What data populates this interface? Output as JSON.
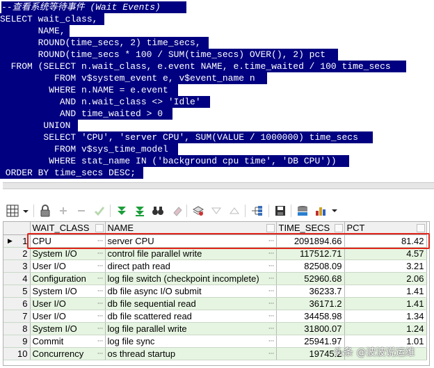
{
  "editor": {
    "lines": [
      {
        "text": "--查看系统等待事件 (Wait Events)",
        "comment": true
      },
      {
        "text": "SELECT wait_class,",
        "comment": false
      },
      {
        "text": "       NAME,",
        "comment": false
      },
      {
        "text": "       ROUND(time_secs, 2) time_secs,",
        "comment": false
      },
      {
        "text": "       ROUND(time_secs * 100 / SUM(time_secs) OVER(), 2) pct",
        "comment": false
      },
      {
        "text": "  FROM (SELECT n.wait_class, e.event NAME, e.time_waited / 100 time_secs",
        "comment": false
      },
      {
        "text": "          FROM v$system_event e, v$event_name n",
        "comment": false
      },
      {
        "text": "         WHERE n.NAME = e.event",
        "comment": false
      },
      {
        "text": "           AND n.wait_class <> 'Idle'",
        "comment": false
      },
      {
        "text": "           AND time_waited > 0",
        "comment": false
      },
      {
        "text": "        UNION",
        "comment": false
      },
      {
        "text": "        SELECT 'CPU', 'server CPU', SUM(VALUE / 1000000) time_secs",
        "comment": false
      },
      {
        "text": "          FROM v$sys_time_model",
        "comment": false
      },
      {
        "text": "         WHERE stat_name IN ('background cpu time', 'DB CPU'))",
        "comment": false
      },
      {
        "text": " ORDER BY time_secs DESC;",
        "comment": false
      }
    ]
  },
  "toolbar": {
    "buttons": [
      {
        "name": "grid-view-icon"
      },
      {
        "name": "lock-icon"
      },
      {
        "name": "add-row-icon"
      },
      {
        "name": "delete-row-icon"
      },
      {
        "name": "post-changes-icon"
      },
      {
        "name": "fetch-next-icon"
      },
      {
        "name": "fetch-all-icon"
      },
      {
        "name": "find-binoculars-icon"
      },
      {
        "name": "clear-eraser-icon"
      },
      {
        "name": "query-by-example-icon"
      },
      {
        "name": "sort-descending-icon"
      },
      {
        "name": "sort-ascending-icon"
      },
      {
        "name": "tree-view-icon"
      },
      {
        "name": "save-icon"
      },
      {
        "name": "export-icon"
      },
      {
        "name": "chart-icon"
      }
    ]
  },
  "grid": {
    "columns": [
      "WAIT_CLASS",
      "NAME",
      "TIME_SECS",
      "PCT"
    ],
    "rows": [
      {
        "num": "1",
        "wait_class": "CPU",
        "name": "server CPU",
        "time_secs": "2091894.66",
        "pct": "81.42"
      },
      {
        "num": "2",
        "wait_class": "System I/O",
        "name": "control file parallel write",
        "time_secs": "117512.71",
        "pct": "4.57"
      },
      {
        "num": "3",
        "wait_class": "User I/O",
        "name": "direct path read",
        "time_secs": "82508.09",
        "pct": "3.21"
      },
      {
        "num": "4",
        "wait_class": "Configuration",
        "name": "log file switch (checkpoint incomplete)",
        "time_secs": "52960.68",
        "pct": "2.06"
      },
      {
        "num": "5",
        "wait_class": "System I/O",
        "name": "db file async I/O submit",
        "time_secs": "36233.7",
        "pct": "1.41"
      },
      {
        "num": "6",
        "wait_class": "User I/O",
        "name": "db file sequential read",
        "time_secs": "36171.2",
        "pct": "1.41"
      },
      {
        "num": "7",
        "wait_class": "User I/O",
        "name": "db file scattered read",
        "time_secs": "34458.98",
        "pct": "1.34"
      },
      {
        "num": "8",
        "wait_class": "System I/O",
        "name": "log file parallel write",
        "time_secs": "31800.07",
        "pct": "1.24"
      },
      {
        "num": "9",
        "wait_class": "Commit",
        "name": "log file sync",
        "time_secs": "25941.97",
        "pct": "1.01"
      },
      {
        "num": "10",
        "wait_class": "Concurrency",
        "name": "os thread startup",
        "time_secs": "19745.2",
        "pct": ""
      }
    ],
    "ellipsis": "···",
    "current_row_indicator": "▶"
  },
  "watermark": "头条 @波波说运维",
  "colors": {
    "selection": "#000080",
    "row_alt": "#e6f5e1",
    "highlight_box": "#e0241a"
  }
}
